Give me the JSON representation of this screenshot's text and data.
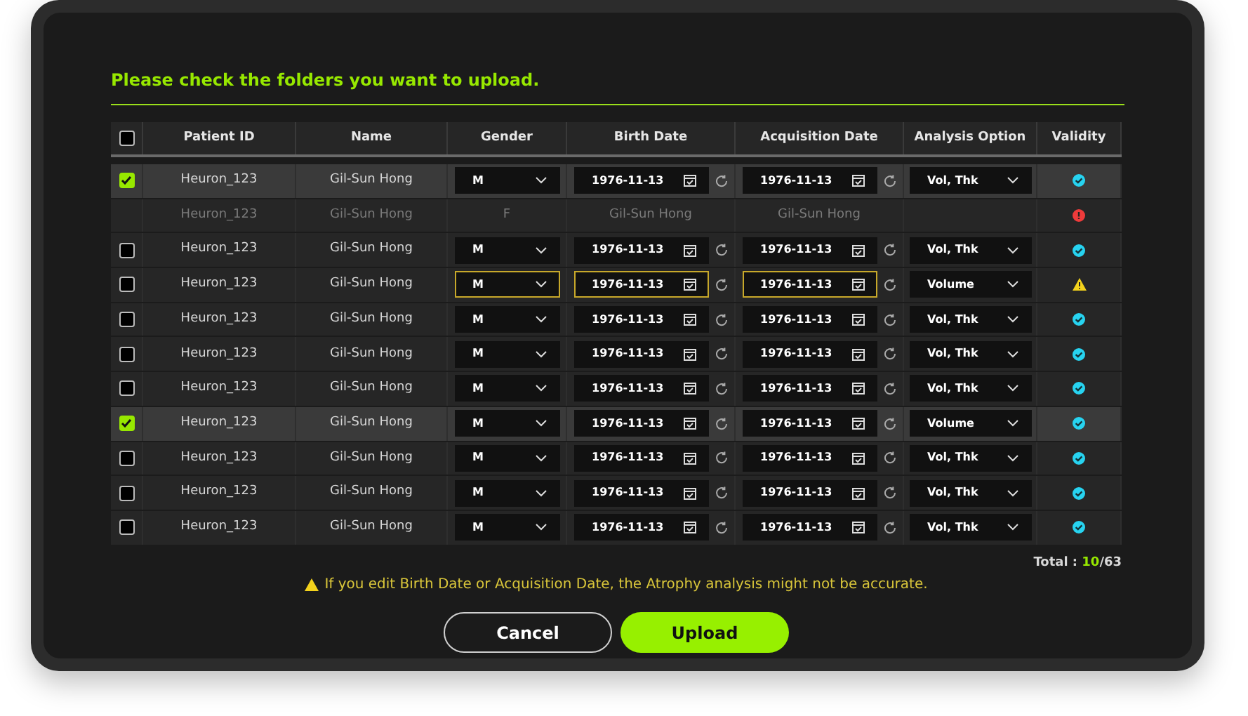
{
  "title": "Please check the folders you want to upload.",
  "table": {
    "header_checkbox": {
      "checked": false
    },
    "columns": [
      "Patient ID",
      "Name",
      "Gender",
      "Birth Date",
      "Acquisition Date",
      "Analysis Option",
      "Validity"
    ],
    "rows": [
      {
        "kind": "editable",
        "selected": true,
        "checked": true,
        "edited": false,
        "patient_id": "Heuron_123",
        "name": "Gil-Sun Hong",
        "gender": "M",
        "birth_date": "1976-11-13",
        "acquisition_date": "1976-11-13",
        "analysis_option": "Vol, Thk",
        "validity": {
          "kind": "valid"
        }
      },
      {
        "kind": "invalid",
        "selected": false,
        "patient_id": "Heuron_123",
        "name": "Gil-Sun Hong",
        "gender": "F",
        "birth_date": "Gil-Sun Hong",
        "acquisition_date": "Gil-Sun Hong",
        "validity": {
          "kind": "error"
        }
      },
      {
        "kind": "editable",
        "selected": false,
        "checked": false,
        "edited": false,
        "patient_id": "Heuron_123",
        "name": "Gil-Sun Hong",
        "gender": "M",
        "birth_date": "1976-11-13",
        "acquisition_date": "1976-11-13",
        "analysis_option": "Vol, Thk",
        "validity": {
          "kind": "valid"
        }
      },
      {
        "kind": "editable",
        "selected": false,
        "checked": false,
        "edited": true,
        "patient_id": "Heuron_123",
        "name": "Gil-Sun Hong",
        "gender": "M",
        "birth_date": "1976-11-13",
        "acquisition_date": "1976-11-13",
        "analysis_option": "Volume",
        "validity": {
          "kind": "warning"
        }
      },
      {
        "kind": "editable",
        "selected": false,
        "checked": false,
        "edited": false,
        "patient_id": "Heuron_123",
        "name": "Gil-Sun Hong",
        "gender": "M",
        "birth_date": "1976-11-13",
        "acquisition_date": "1976-11-13",
        "analysis_option": "Vol, Thk",
        "validity": {
          "kind": "valid"
        }
      },
      {
        "kind": "editable",
        "selected": false,
        "checked": false,
        "edited": false,
        "patient_id": "Heuron_123",
        "name": "Gil-Sun Hong",
        "gender": "M",
        "birth_date": "1976-11-13",
        "acquisition_date": "1976-11-13",
        "analysis_option": "Vol, Thk",
        "validity": {
          "kind": "valid"
        }
      },
      {
        "kind": "editable",
        "selected": false,
        "checked": false,
        "edited": false,
        "patient_id": "Heuron_123",
        "name": "Gil-Sun Hong",
        "gender": "M",
        "birth_date": "1976-11-13",
        "acquisition_date": "1976-11-13",
        "analysis_option": "Vol, Thk",
        "validity": {
          "kind": "valid"
        }
      },
      {
        "kind": "editable",
        "selected": true,
        "checked": true,
        "edited": false,
        "patient_id": "Heuron_123",
        "name": "Gil-Sun Hong",
        "gender": "M",
        "birth_date": "1976-11-13",
        "acquisition_date": "1976-11-13",
        "analysis_option": "Volume",
        "validity": {
          "kind": "valid"
        }
      },
      {
        "kind": "editable",
        "selected": false,
        "checked": false,
        "edited": false,
        "patient_id": "Heuron_123",
        "name": "Gil-Sun Hong",
        "gender": "M",
        "birth_date": "1976-11-13",
        "acquisition_date": "1976-11-13",
        "analysis_option": "Vol, Thk",
        "validity": {
          "kind": "valid"
        }
      },
      {
        "kind": "editable",
        "selected": false,
        "checked": false,
        "edited": false,
        "patient_id": "Heuron_123",
        "name": "Gil-Sun Hong",
        "gender": "M",
        "birth_date": "1976-11-13",
        "acquisition_date": "1976-11-13",
        "analysis_option": "Vol, Thk",
        "validity": {
          "kind": "valid"
        }
      },
      {
        "kind": "editable",
        "selected": false,
        "checked": false,
        "edited": false,
        "patient_id": "Heuron_123",
        "name": "Gil-Sun Hong",
        "gender": "M",
        "birth_date": "1976-11-13",
        "acquisition_date": "1976-11-13",
        "analysis_option": "Vol, Thk",
        "validity": {
          "kind": "valid"
        }
      }
    ]
  },
  "total": {
    "label": "Total :",
    "selected_count": "10",
    "count": "/63"
  },
  "warning": "If you edit Birth Date or Acquisition Date, the Atrophy analysis might not be accurate.",
  "buttons": {
    "cancel": "Cancel",
    "upload": "Upload"
  }
}
